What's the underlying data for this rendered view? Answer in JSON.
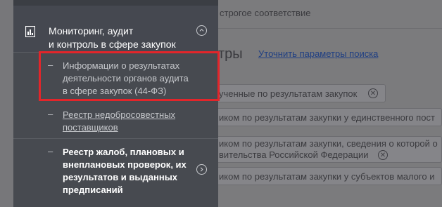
{
  "background": {
    "top_text": "строгое соответствие",
    "heading_partial": "тры",
    "refine_link": "Уточнить параметры поиска",
    "chips": [
      {
        "text": "ученные по результатам закупок",
        "has_close": true
      },
      {
        "text": "иком по результатам закупки у единственного пост",
        "has_close": false
      },
      {
        "text_line1": "иком по результатам закупки, сведения о которой о",
        "text_line2": "вительства Российской Федерации",
        "has_close": true
      },
      {
        "text": "иком по результатам закупки у субъектов малого и",
        "has_close": false
      }
    ]
  },
  "menu": {
    "section": {
      "title_line1": "Мониторинг, аудит",
      "title_line2": "и контроль в сфере закупок",
      "icon": "chart-report-icon",
      "toggle_icon": "chevron-up-icon"
    },
    "items": [
      {
        "dash": "–",
        "line1": "Информации о результатах",
        "line2": "деятельности органов аудита",
        "line3": "в сфере закупок (44-ФЗ)"
      },
      {
        "dash": "–",
        "line1": "Реестр недобросовестных",
        "line2": "поставщиков"
      },
      {
        "dash": "–",
        "line1": "Реестр жалоб, плановых и",
        "line2": "внеплановых проверок, их",
        "line3": "результатов и выданных",
        "line4": "предписаний",
        "toggle_icon": "chevron-right-icon"
      }
    ]
  },
  "colors": {
    "menu_bg": "#474a50",
    "highlight": "#e3252a",
    "link": "#1f3f83"
  }
}
